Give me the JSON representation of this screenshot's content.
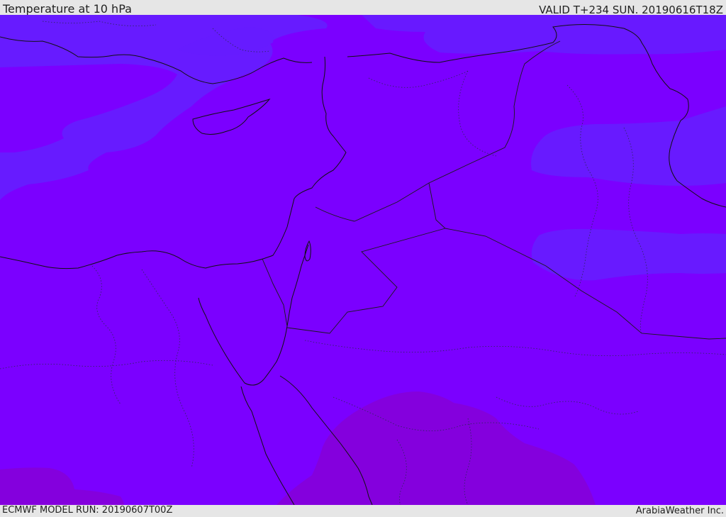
{
  "header": {
    "title": "Temperature at 10 hPa",
    "valid": "VALID T+234 SUN. 20190616T18Z"
  },
  "footer": {
    "model_run": "ECMWF MODEL RUN: 20190607T00Z",
    "credit": "ArabiaWeather Inc."
  },
  "colors": {
    "base_field": "#7b00ff",
    "cooler_band": "#661cff",
    "warmer_band": "#8400dd",
    "warmest_band": "#8a00c8",
    "background": "#e6e6e6"
  },
  "map": {
    "region": "Eastern Mediterranean and Middle East",
    "field": "temperature"
  }
}
